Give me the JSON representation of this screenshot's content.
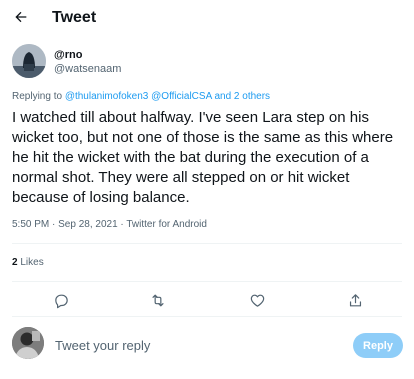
{
  "header": {
    "title": "Tweet"
  },
  "author": {
    "name": "@rno",
    "handle": "@watsenaam"
  },
  "replying": {
    "prefix": "Replying to ",
    "user1": "@thulanimofoken3",
    "user2": "@OfficialCSA",
    "and_others": " and 2 others"
  },
  "tweet": {
    "text": "I watched till about halfway. I've seen Lara step on his wicket too, but not one of those is the same as this where he hit the wicket with the bat during the execution of a normal shot. They were all stepped on or hit wicket because of losing balance."
  },
  "meta": {
    "time": "5:50 PM",
    "date": "Sep 28, 2021",
    "separator": " · ",
    "source": "Twitter for Android"
  },
  "stats": {
    "likes_count": "2",
    "likes_label": "Likes"
  },
  "reply": {
    "placeholder": "Tweet your reply",
    "button_label": "Reply"
  },
  "colors": {
    "accent": "#1d9bf0",
    "reply_button_disabled": "#8ecdf8",
    "secondary_text": "#536471"
  },
  "icons": [
    "back-arrow-icon",
    "reply-icon",
    "retweet-icon",
    "like-icon",
    "share-icon"
  ]
}
